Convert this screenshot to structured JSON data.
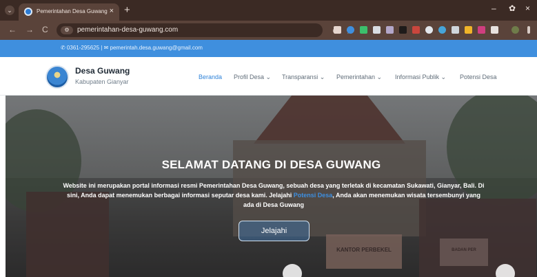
{
  "browser": {
    "tab_title": "Pemerintahan Desa Guwang",
    "tab_close": "×",
    "new_tab": "+",
    "chevron": "⌄",
    "url": "pemerintahan-desa-guwang.com",
    "window_controls": [
      "–",
      "✿",
      "×"
    ],
    "nav": [
      "←",
      "→",
      "C"
    ]
  },
  "contact": {
    "text": "✆ 0361-295625 | ✉ pemerintah.desa.guwang@gmail.com"
  },
  "site": {
    "name": "Desa Guwang",
    "subtitle": "Kabupaten Gianyar"
  },
  "nav": {
    "items": [
      {
        "label": "Beranda",
        "active": true
      },
      {
        "label": "Profil Desa ⌄",
        "active": false
      },
      {
        "label": "Transparansi ⌄",
        "active": false
      },
      {
        "label": "Pemerintahan ⌄",
        "active": false
      },
      {
        "label": "Informasi Publik ⌄",
        "active": false
      },
      {
        "label": "Potensi Desa",
        "active": false
      }
    ]
  },
  "hero": {
    "title": "SELAMAT DATANG DI DESA GUWANG",
    "desc_part1": "Website ini merupakan portal informasi resmi Pemerintahan Desa Guwang, sebuah desa yang terletak di kecamatan Sukawati, Gianyar, Bali. Di sini, Anda dapat menemukan berbagai informasi seputar desa kami. Jelajahi ",
    "desc_link": "Potensi Desa",
    "desc_part2": ", Anda akan menemukan wisata tersembunyi yang ada di Desa Guwang",
    "button": "Jelajahi",
    "sign_text": "KANTOR PERBEKEL",
    "sign_text2": "BADAN PER"
  },
  "colors": {
    "accent": "#3f8fde",
    "browser_dark": "#3b2a24",
    "browser_mid": "#5a433a"
  }
}
